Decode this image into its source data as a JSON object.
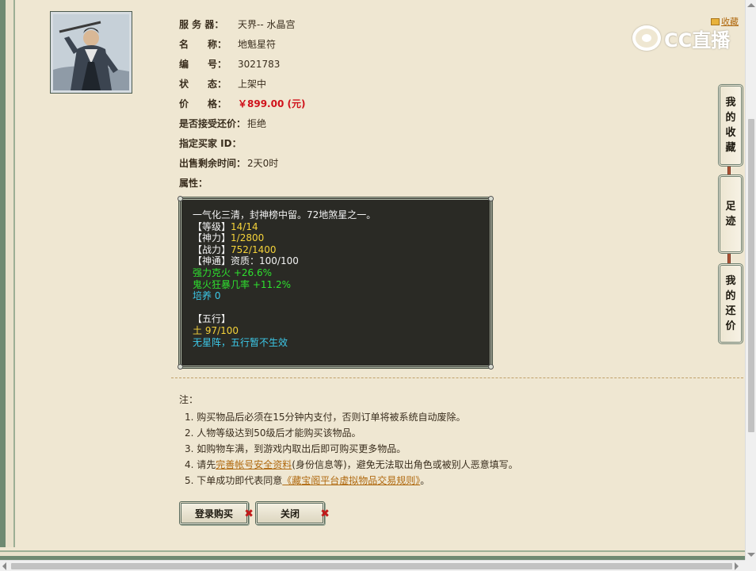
{
  "item": {
    "rows": [
      {
        "label": "服 务 器：",
        "value": "天界-- 水晶宫"
      },
      {
        "label": "名　　称：",
        "value": "地魁星符"
      },
      {
        "label": "编　　号：",
        "value": "3021783"
      },
      {
        "label": "状　　态：",
        "value": "上架中"
      }
    ],
    "price_label": "价　　格：",
    "price_value": "￥899.00 (元)",
    "counter_label": "是否接受还价：",
    "counter_value": "拒绝",
    "buyer_label": "指定买家 ID：",
    "buyer_value": "",
    "time_label": "出售剩余时间：",
    "time_value": "2天0时",
    "attr_label": "属性："
  },
  "attributes": {
    "desc": "一气化三清，封神榜中留。72地煞星之一。",
    "level_key": "【等级】",
    "level_val": "14/14",
    "power_key": "【神力】",
    "power_val": "1/2800",
    "combat_key": "【战力】",
    "combat_val": "752/1400",
    "skill_key": "【神通】",
    "skill_val": "资质：100/100",
    "bonus1": "强力克火 +26.6%",
    "bonus2": "鬼火狂暴几率 +11.2%",
    "cultivate": "培养 0",
    "wuxing_title": "【五行】",
    "wuxing_val": "土 97/100",
    "wuxing_note": "无星阵，五行暂不生效"
  },
  "notes": {
    "title": "注：",
    "n1": "1. 购买物品后必须在15分钟内支付，否则订单将被系统自动废除。",
    "n2": "2. 人物等级达到50级后才能购买该物品。",
    "n3": "3. 如购物车满，到游戏内取出后即可购买更多物品。",
    "n4_a": "4. 请先",
    "n4_link": "完善帐号安全资料",
    "n4_b": "(身份信息等)，避免无法取出角色或被别人恶意填写。",
    "n5_a": "5. 下单成功即代表同意",
    "n5_link": "《藏宝阁平台虚拟物品交易规则》",
    "n5_b": "。"
  },
  "buttons": {
    "buy": "登录购买",
    "close": "关闭",
    "x": "✖"
  },
  "side_tabs": {
    "favorites": [
      "我",
      "的",
      "收",
      "藏"
    ],
    "footprint": [
      "足",
      "迹"
    ],
    "my_offer": [
      "我",
      "的",
      "还",
      "价"
    ]
  },
  "top_right": {
    "favorite_link": "收藏",
    "logo_text": "CC直播"
  },
  "colors": {
    "price": "#d0121b",
    "attr_white": "#f2f2f2",
    "attr_yellow": "#f5d33a",
    "attr_green": "#2ee02e",
    "attr_cyan": "#3cc8e8",
    "link": "#b06a10"
  }
}
